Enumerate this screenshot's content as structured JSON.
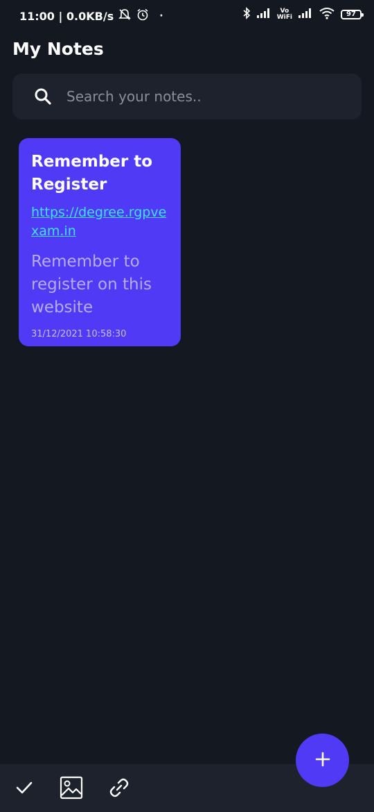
{
  "status_bar": {
    "time_speed": "11:00 | 0.0KB/s",
    "dot": "·",
    "vo": "Vo",
    "wifi_label": "WiFi",
    "battery": "97"
  },
  "header": {
    "title": "My Notes"
  },
  "search": {
    "placeholder": "Search your notes..",
    "value": ""
  },
  "notes": [
    {
      "title": "Remember to Register",
      "link": "https://degree.rgpvexam.in",
      "body": "Remember to register on this website",
      "date": "31/12/2021 10:58:30"
    }
  ],
  "colors": {
    "background": "#141820",
    "surface": "#1e222c",
    "accent": "#4f3bf6",
    "link": "#40e0ff"
  },
  "icons": {
    "fab": "plus-icon",
    "bottom": [
      "check-icon",
      "image-icon",
      "link-icon"
    ]
  }
}
